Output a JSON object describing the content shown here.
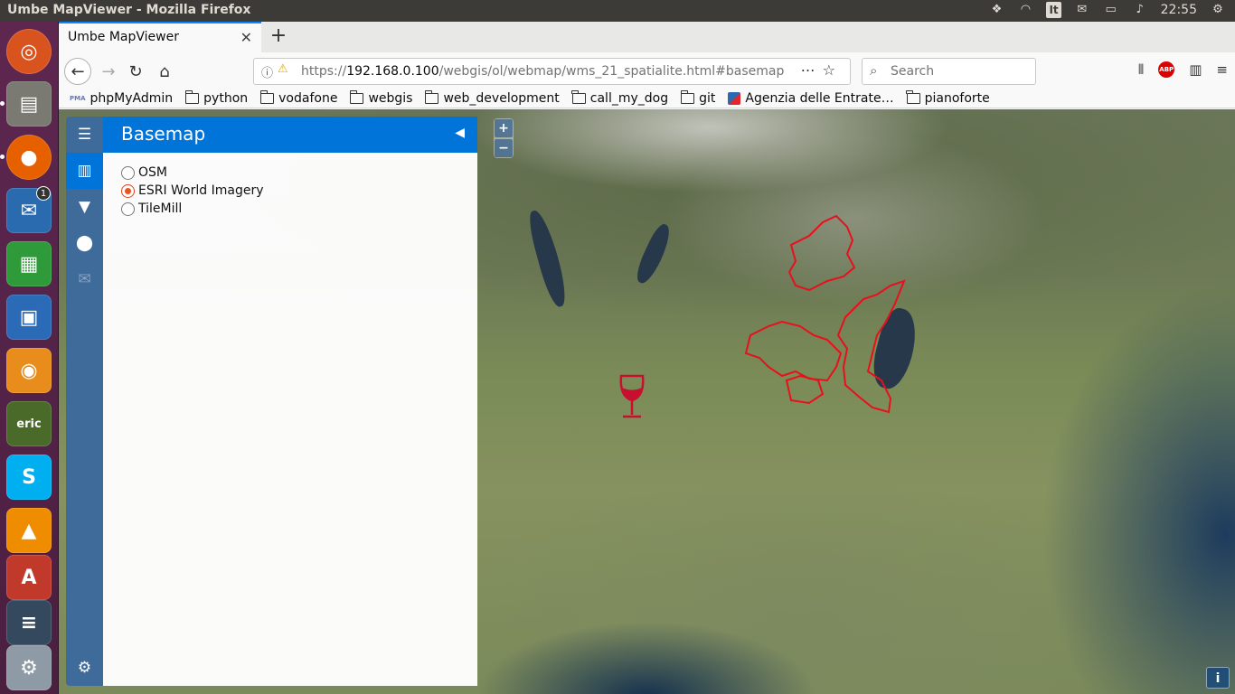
{
  "window_title": "Umbe MapViewer - Mozilla Firefox",
  "system_tray": {
    "language": "It",
    "clock": "22:55"
  },
  "launcher": {
    "notification_badge": "1",
    "items": [
      "ubuntu-dash",
      "files",
      "firefox",
      "thunderbird",
      "libreoffice-calc",
      "libreoffice-impress",
      "blender",
      "eric-ide",
      "skype",
      "vlc",
      "software-center",
      "app-stack",
      "system-settings"
    ]
  },
  "browser": {
    "tab_title": "Umbe MapViewer",
    "url": {
      "scheme": "https://",
      "host": "192.168.0.100",
      "path": "/webgis/ol/webmap/wms_21_spatialite.html#basemap"
    },
    "search_placeholder": "Search",
    "bookmarks": [
      "phpMyAdmin",
      "python",
      "vodafone",
      "webgis",
      "web_development",
      "call_my_dog",
      "git",
      "Agenzia delle Entrate…",
      "pianoforte"
    ]
  },
  "sidebar": {
    "pane_title": "Basemap",
    "tabs": [
      "menu",
      "basemap",
      "filter",
      "marker",
      "mail",
      "settings"
    ],
    "basemap_options": [
      {
        "label": "OSM",
        "checked": false
      },
      {
        "label": "ESRI World Imagery",
        "checked": true
      },
      {
        "label": "TileMill",
        "checked": false
      }
    ]
  },
  "map": {
    "zoom_in": "+",
    "zoom_out": "−",
    "info_label": "i",
    "highlight_color": "#e8101c",
    "marker_icon": "wine-glass-icon"
  }
}
